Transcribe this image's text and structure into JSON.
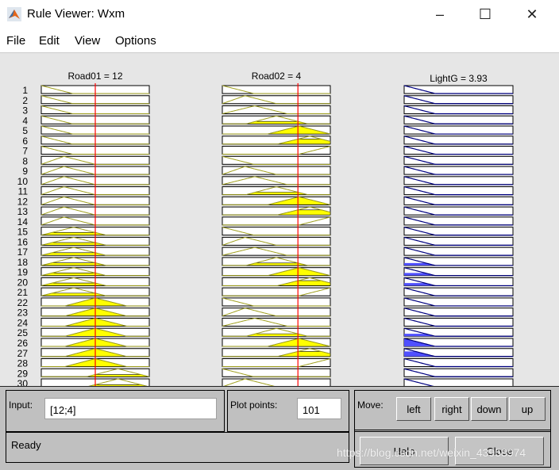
{
  "window": {
    "title": "Rule Viewer: Wxm",
    "minimize": "–",
    "maximize": "☐",
    "close": "✕"
  },
  "menu": [
    "File",
    "Edit",
    "View",
    "Options"
  ],
  "variables": [
    {
      "header": "Road01 = 12",
      "kind": "input",
      "value_fraction": 0.5
    },
    {
      "header": "Road02 = 4",
      "kind": "input",
      "value_fraction": 0.7
    },
    {
      "header": "LightG = 3.93",
      "kind": "output"
    }
  ],
  "colors": {
    "input_fill": "#ffff00",
    "input_line": "#a0a020",
    "output_line": "#000080",
    "output_fill": "#5050ff",
    "value_line": "#ff0000"
  },
  "rules": [
    [
      1,
      1,
      1
    ],
    [
      1,
      2,
      1
    ],
    [
      1,
      3,
      1
    ],
    [
      1,
      4,
      1
    ],
    [
      1,
      5,
      1
    ],
    [
      1,
      6,
      1
    ],
    [
      1,
      7,
      1
    ],
    [
      2,
      1,
      1
    ],
    [
      2,
      2,
      1
    ],
    [
      2,
      3,
      1
    ],
    [
      2,
      4,
      1
    ],
    [
      2,
      5,
      1
    ],
    [
      2,
      6,
      1
    ],
    [
      2,
      7,
      1
    ],
    [
      3,
      1,
      1
    ],
    [
      3,
      2,
      1
    ],
    [
      3,
      3,
      1
    ],
    [
      3,
      4,
      1
    ],
    [
      3,
      5,
      1
    ],
    [
      3,
      6,
      1
    ],
    [
      3,
      7,
      1
    ],
    [
      4,
      1,
      1
    ],
    [
      4,
      2,
      1
    ],
    [
      4,
      3,
      1
    ],
    [
      4,
      4,
      1
    ],
    [
      4,
      5,
      1
    ],
    [
      4,
      6,
      1
    ],
    [
      4,
      7,
      1
    ],
    [
      5,
      1,
      1
    ],
    [
      5,
      2,
      1
    ]
  ],
  "controls": {
    "input_label": "Input:",
    "input_value": "[12;4]",
    "plot_points_label": "Plot points:",
    "plot_points_value": "101",
    "move_label": "Move:",
    "left": "left",
    "right": "right",
    "down": "down",
    "up": "up",
    "status": "Ready",
    "help": "Help",
    "close": "Close"
  },
  "watermark": "https://blog.csdn.net/weixin_43958974"
}
